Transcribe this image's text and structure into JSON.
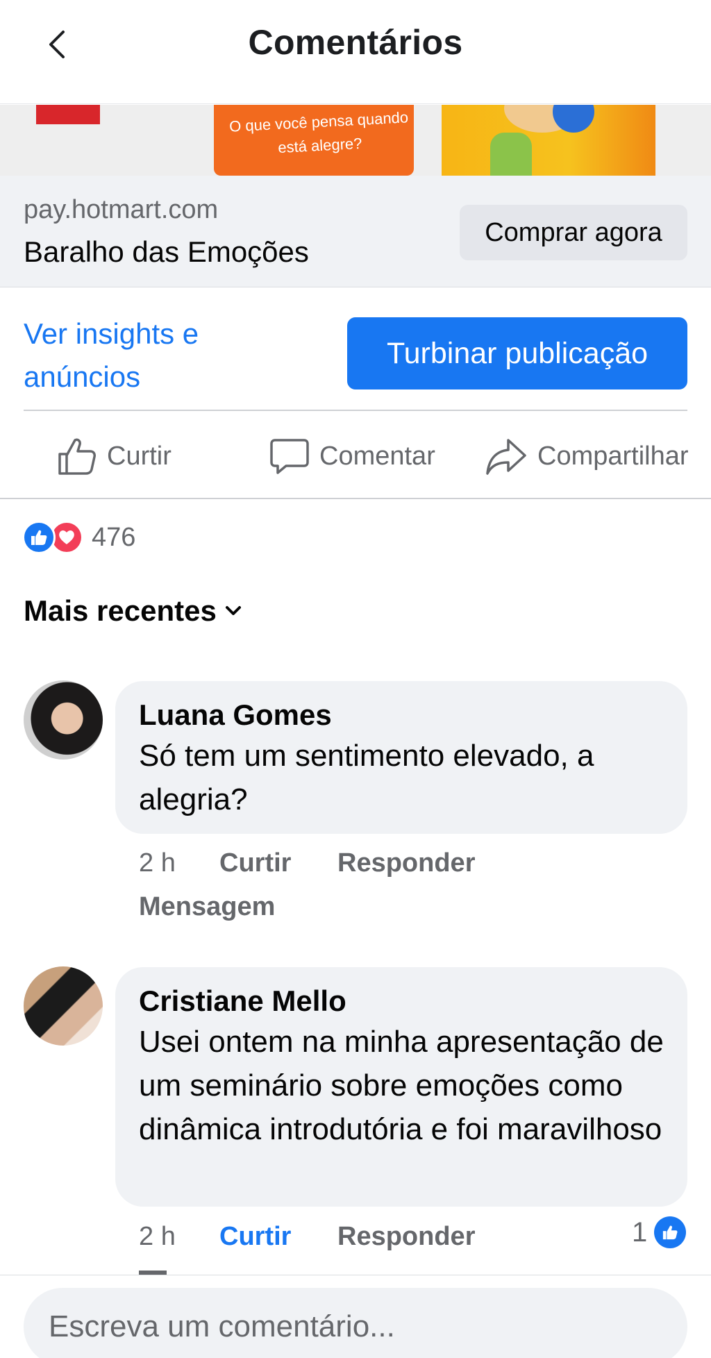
{
  "header": {
    "title": "Comentários"
  },
  "preview_card": {
    "image_text": "O que você pensa quando está alegre?",
    "domain": "pay.hotmart.com",
    "title": "Baralho das Emoções",
    "cta_label": "Comprar agora"
  },
  "post_actions": {
    "insights_link": "Ver insights e anúncios",
    "boost_label": "Turbinar publicação",
    "like_label": "Curtir",
    "comment_label": "Comentar",
    "share_label": "Compartilhar"
  },
  "reactions": {
    "count": "476"
  },
  "sort": {
    "label": "Mais recentes"
  },
  "comments": [
    {
      "author": "Luana Gomes",
      "text": "Só tem um sentimento elevado, a alegria?",
      "time": "2 h",
      "like_label": "Curtir",
      "reply_label": "Responder",
      "message_label": "Mensagem",
      "liked": false
    },
    {
      "author": "Cristiane Mello",
      "text": "Usei ontem na minha apresentação  de um seminário sobre emoções  como dinâmica introdutória  e foi maravilhoso",
      "time": "2 h",
      "like_label": "Curtir",
      "reply_label": "Responder",
      "liked": true,
      "like_count": "1"
    }
  ],
  "composer": {
    "placeholder": "Escreva um comentário..."
  },
  "colors": {
    "accent": "#1877f2",
    "love": "#f33e58",
    "bubble": "#f0f2f5",
    "secondary_text": "#65676b"
  }
}
